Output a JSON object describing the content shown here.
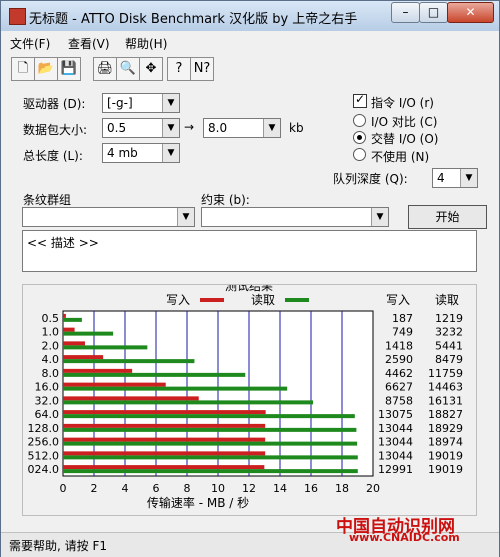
{
  "window": {
    "title": "无标题 - ATTO Disk Benchmark  汉化版 by 上帝之右手"
  },
  "title_buttons": {
    "min": "–",
    "max": "□",
    "close": "✕"
  },
  "menu": {
    "file": "文件(F)",
    "view": "查看(V)",
    "help": "帮助(H)"
  },
  "toolbar_icons": {
    "new": "🗋",
    "open": "📂",
    "save": "💾",
    "print": "🖨",
    "preview": "🔍",
    "move": "✥",
    "help": "?",
    "context_help": "N?"
  },
  "settings": {
    "drive_label": "驱动器 (D):",
    "drive_value": "[-g-]",
    "transfer_label": "数据包大小:",
    "transfer_from": "0.5",
    "arrow": "→",
    "transfer_to": "8.0",
    "transfer_unit": "kb",
    "length_label": "总长度 (L):",
    "length_value": "4 mb",
    "io_label": "指令 I/O (r)",
    "io_checked": true,
    "compare_label": "I/O 对比 (C)",
    "overlap_label": "交替 I/O (O)",
    "neither_label": "不使用 (N)",
    "queue_label": "队列深度 (Q):",
    "queue_value": "4",
    "stripe_label": "条纹群组",
    "constraint_label": "约束 (b):",
    "start_label": "开始",
    "description": "<< 描述 >>"
  },
  "results": {
    "group_title": "测试结果",
    "write_col": "写入",
    "read_col": "读取"
  },
  "status": {
    "text": "需要帮助, 请按 F1"
  },
  "watermark": {
    "text": "中国自动识别网",
    "url": "www.CNAIDC.com"
  },
  "chart_data": {
    "type": "bar",
    "title": "",
    "xlabel": "传输速率 - MB / 秒",
    "ylabel": "",
    "xlim": [
      0,
      20
    ],
    "xticks": [
      0,
      2,
      4,
      6,
      8,
      10,
      12,
      14,
      16,
      18,
      20
    ],
    "categories": [
      "0.5",
      "1.0",
      "2.0",
      "4.0",
      "8.0",
      "16.0",
      "32.0",
      "64.0",
      "128.0",
      "256.0",
      "512.0",
      "024.0"
    ],
    "legend_position": "top",
    "series": [
      {
        "name": "写入",
        "color": "#cc1f1f",
        "values": [
          187,
          749,
          1418,
          2590,
          4462,
          6627,
          8758,
          13075,
          13044,
          13044,
          13044,
          12991
        ]
      },
      {
        "name": "读取",
        "color": "#1e8a1e",
        "values": [
          1219,
          3232,
          5441,
          8479,
          11759,
          14463,
          16131,
          18827,
          18929,
          18974,
          19019,
          19019
        ]
      }
    ]
  }
}
